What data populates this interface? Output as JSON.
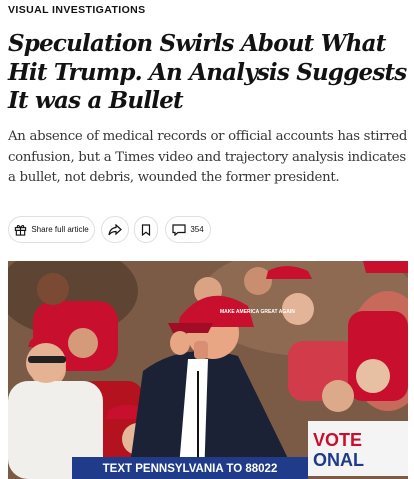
{
  "kicker": "VISUAL INVESTIGATIONS",
  "headline": "Speculation Swirls About What Hit Trump. An Analysis Suggests It was a Bullet",
  "summary": "An absence of medical records or official accounts has stirred confusion, but a Times video and trajectory analysis indicates a bullet, not debris, wounded the former president.",
  "toolbar": {
    "share_label": "Share full article",
    "share_icon": "gift-icon",
    "forward_icon": "share-arrow-icon",
    "bookmark_icon": "bookmark-icon",
    "comment_icon": "comment-icon",
    "comment_count": "354"
  },
  "photo": {
    "cap_text": "MAKE AMERICA GREAT AGAIN",
    "podium_text": "TEXT PENNSYLVANIA TO 88022",
    "sign_text_1": "VOTE",
    "sign_text_2": "ONAL",
    "accent_red": "#c8102e",
    "podium_blue": "#1f3b8a"
  }
}
